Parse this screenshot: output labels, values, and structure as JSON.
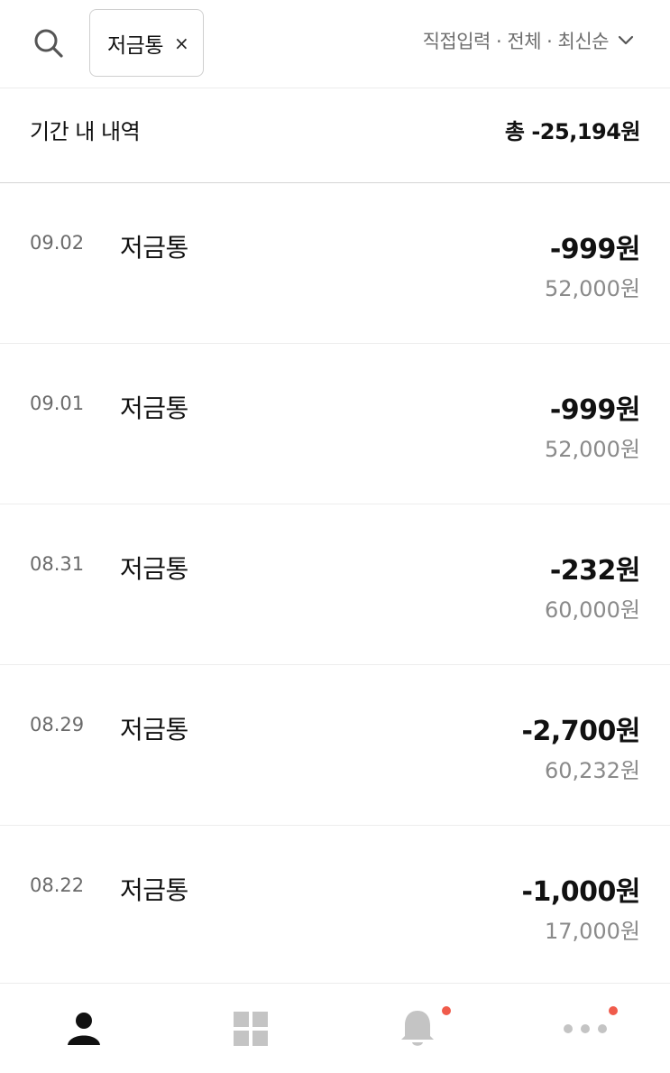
{
  "header": {
    "search_icon": "search-icon",
    "chip": {
      "label": "저금통",
      "close": "×"
    },
    "filter": {
      "label": "직접입력 · 전체 · 최신순",
      "icon": "chevron-down-icon"
    }
  },
  "summary": {
    "label": "기간 내 내역",
    "total": "총 -25,194원"
  },
  "transactions": [
    {
      "date": "09.02",
      "name": "저금통",
      "amount": "-999원",
      "balance": "52,000원"
    },
    {
      "date": "09.01",
      "name": "저금통",
      "amount": "-999원",
      "balance": "52,000원"
    },
    {
      "date": "08.31",
      "name": "저금통",
      "amount": "-232원",
      "balance": "60,000원"
    },
    {
      "date": "08.29",
      "name": "저금통",
      "amount": "-2,700원",
      "balance": "60,232원"
    },
    {
      "date": "08.22",
      "name": "저금통",
      "amount": "-1,000원",
      "balance": "17,000원"
    }
  ],
  "bottom_nav": [
    {
      "icon": "person-icon",
      "active": true,
      "badge": false
    },
    {
      "icon": "grid-icon",
      "active": false,
      "badge": false
    },
    {
      "icon": "bell-icon",
      "active": false,
      "badge": true
    },
    {
      "icon": "more-dots-icon",
      "active": false,
      "badge": true
    }
  ],
  "colors": {
    "text": "#111111",
    "muted": "#8a8a8a",
    "inactive_icon": "#c4c4c4",
    "badge": "#f05b4b"
  }
}
